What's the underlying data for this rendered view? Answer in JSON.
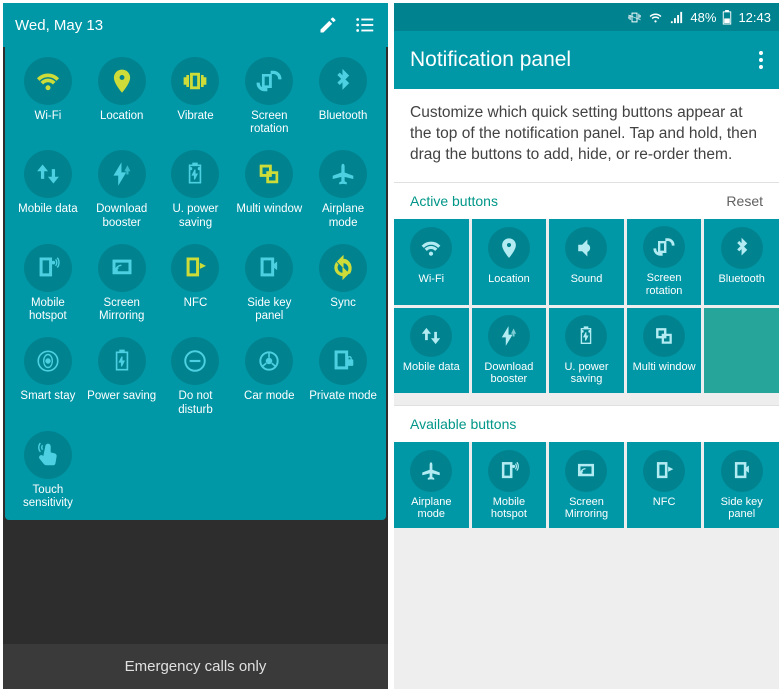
{
  "left": {
    "date": "Wed, May 13",
    "emergency": "Emergency calls only",
    "toggles": [
      {
        "id": "wifi",
        "label": "Wi-Fi",
        "active": true,
        "icon": "wifi"
      },
      {
        "id": "location",
        "label": "Location",
        "active": true,
        "icon": "location"
      },
      {
        "id": "vibrate",
        "label": "Vibrate",
        "active": true,
        "icon": "vibrate"
      },
      {
        "id": "screen-rotation",
        "label": "Screen rotation",
        "active": false,
        "icon": "rotation"
      },
      {
        "id": "bluetooth",
        "label": "Bluetooth",
        "active": false,
        "icon": "bluetooth"
      },
      {
        "id": "mobile-data",
        "label": "Mobile data",
        "active": false,
        "icon": "mobiledata"
      },
      {
        "id": "download-booster",
        "label": "Download booster",
        "active": false,
        "icon": "booster"
      },
      {
        "id": "u-power-saving",
        "label": "U. power saving",
        "active": false,
        "icon": "upower"
      },
      {
        "id": "multi-window",
        "label": "Multi window",
        "active": true,
        "icon": "multiwindow"
      },
      {
        "id": "airplane-mode",
        "label": "Airplane mode",
        "active": false,
        "icon": "airplane"
      },
      {
        "id": "mobile-hotspot",
        "label": "Mobile hotspot",
        "active": false,
        "icon": "hotspot"
      },
      {
        "id": "screen-mirroring",
        "label": "Screen Mirroring",
        "active": false,
        "icon": "mirroring"
      },
      {
        "id": "nfc",
        "label": "NFC",
        "active": true,
        "icon": "nfc"
      },
      {
        "id": "side-key-panel",
        "label": "Side key panel",
        "active": false,
        "icon": "sidekey"
      },
      {
        "id": "sync",
        "label": "Sync",
        "active": true,
        "icon": "sync"
      },
      {
        "id": "smart-stay",
        "label": "Smart stay",
        "active": false,
        "icon": "smartstay"
      },
      {
        "id": "power-saving",
        "label": "Power saving",
        "active": false,
        "icon": "powersaving"
      },
      {
        "id": "do-not-disturb",
        "label": "Do not disturb",
        "active": false,
        "icon": "dnd"
      },
      {
        "id": "car-mode",
        "label": "Car mode",
        "active": false,
        "icon": "car"
      },
      {
        "id": "private-mode",
        "label": "Private mode",
        "active": false,
        "icon": "private"
      },
      {
        "id": "touch-sensitivity",
        "label": "Touch sensitivity",
        "active": false,
        "icon": "touch"
      }
    ]
  },
  "right": {
    "status": {
      "battery_pct": "48%",
      "time": "12:43"
    },
    "title": "Notification panel",
    "description": "Customize which quick setting buttons appear at the top of the notification panel. Tap and hold, then drag the buttons to add, hide, or re-order them.",
    "active_header": "Active buttons",
    "reset_label": "Reset",
    "available_header": "Available buttons",
    "active_buttons": [
      {
        "id": "wifi",
        "label": "Wi-Fi",
        "icon": "wifi"
      },
      {
        "id": "location",
        "label": "Location",
        "icon": "location"
      },
      {
        "id": "sound",
        "label": "Sound",
        "icon": "sound"
      },
      {
        "id": "screen-rotation",
        "label": "Screen rotation",
        "icon": "rotation"
      },
      {
        "id": "bluetooth",
        "label": "Bluetooth",
        "icon": "bluetooth"
      },
      {
        "id": "mobile-data",
        "label": "Mobile data",
        "icon": "mobiledata"
      },
      {
        "id": "download-booster",
        "label": "Download booster",
        "icon": "booster"
      },
      {
        "id": "u-power-saving",
        "label": "U. power saving",
        "icon": "upower"
      },
      {
        "id": "multi-window",
        "label": "Multi window",
        "icon": "multiwindow"
      },
      {
        "id": "empty",
        "label": "",
        "icon": "",
        "empty": true
      }
    ],
    "available_buttons": [
      {
        "id": "airplane-mode",
        "label": "Airplane mode",
        "icon": "airplane"
      },
      {
        "id": "mobile-hotspot",
        "label": "Mobile hotspot",
        "icon": "hotspot"
      },
      {
        "id": "screen-mirroring",
        "label": "Screen Mirroring",
        "icon": "mirroring"
      },
      {
        "id": "nfc",
        "label": "NFC",
        "icon": "nfc"
      },
      {
        "id": "side-key-panel",
        "label": "Side key panel",
        "icon": "sidekey"
      }
    ]
  },
  "colors": {
    "teal_main": "#0097a7",
    "teal_dark": "#00838f",
    "lime_active": "#cddc39",
    "cyan_inactive": "#4dd0e1"
  }
}
